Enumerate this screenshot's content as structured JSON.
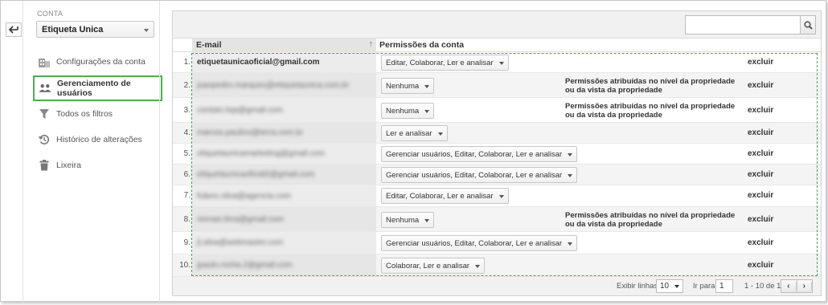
{
  "sidebar": {
    "account_label": "CONTA",
    "account_value": "Etiqueta Unica",
    "items": [
      {
        "label": "Configurações da conta",
        "icon": "building-icon",
        "active": false
      },
      {
        "label": "Gerenciamento de usuários",
        "icon": "users-icon",
        "active": true
      },
      {
        "label": "Todos os filtros",
        "icon": "filter-icon",
        "active": false
      },
      {
        "label": "Histórico de alterações",
        "icon": "history-icon",
        "active": false
      },
      {
        "label": "Lixeira",
        "icon": "trash-icon",
        "active": false
      }
    ]
  },
  "table": {
    "col_email": "E-mail",
    "col_perm": "Permissões da conta",
    "rows": [
      {
        "num": "1.",
        "email": "etiquetaunicaoficial@gmail.com",
        "blurred": false,
        "perm": "Editar, Colaborar, Ler e analisar",
        "note": "",
        "action": "excluir"
      },
      {
        "num": "2.",
        "email": "joaopedro.marques@etiquetaunica.com.br",
        "blurred": true,
        "perm": "Nenhuma",
        "note": "Permissões atribuídas no nível da propriedade ou da vista da propriedade",
        "action": "excluir"
      },
      {
        "num": "3.",
        "email": "contato.loja@gmail.com",
        "blurred": true,
        "perm": "Nenhuma",
        "note": "Permissões atribuídas no nível da propriedade ou da vista da propriedade",
        "action": "excluir"
      },
      {
        "num": "4.",
        "email": "marcos.paulino@terra.com.br",
        "blurred": true,
        "perm": "Ler e analisar",
        "note": "",
        "action": "excluir"
      },
      {
        "num": "5.",
        "email": "etiquetaunicamarketing@gmail.com",
        "blurred": true,
        "perm": "Gerenciar usuários, Editar, Colaborar, Ler e analisar",
        "note": "",
        "action": "excluir"
      },
      {
        "num": "6.",
        "email": "etiquetaunicaoficial2@gmail.com",
        "blurred": true,
        "perm": "Gerenciar usuários, Editar, Colaborar, Ler e analisar",
        "note": "",
        "action": "excluir"
      },
      {
        "num": "7.",
        "email": "fulano.silva@agencia.com",
        "blurred": true,
        "perm": "Editar, Colaborar, Ler e analisar",
        "note": "",
        "action": "excluir"
      },
      {
        "num": "8.",
        "email": "rennan.lima@gmail.com",
        "blurred": true,
        "perm": "Nenhuma",
        "note": "Permissões atribuídas no nível da propriedade ou da vista da propriedade",
        "action": "excluir"
      },
      {
        "num": "9.",
        "email": "jl.silva@webmaster.com",
        "blurred": true,
        "perm": "Gerenciar usuários, Editar, Colaborar, Ler e analisar",
        "note": "",
        "action": "excluir"
      },
      {
        "num": "10.",
        "email": "jpaulo.rocha.2@gmail.com",
        "blurred": true,
        "perm": "Colaborar, Ler e analisar",
        "note": "",
        "action": "excluir"
      }
    ]
  },
  "footer": {
    "rows_label": "Exibir linhas:",
    "rows_value": "10",
    "goto_label": "Ir para:",
    "goto_value": "1",
    "range": "1 - 10 de 14"
  }
}
